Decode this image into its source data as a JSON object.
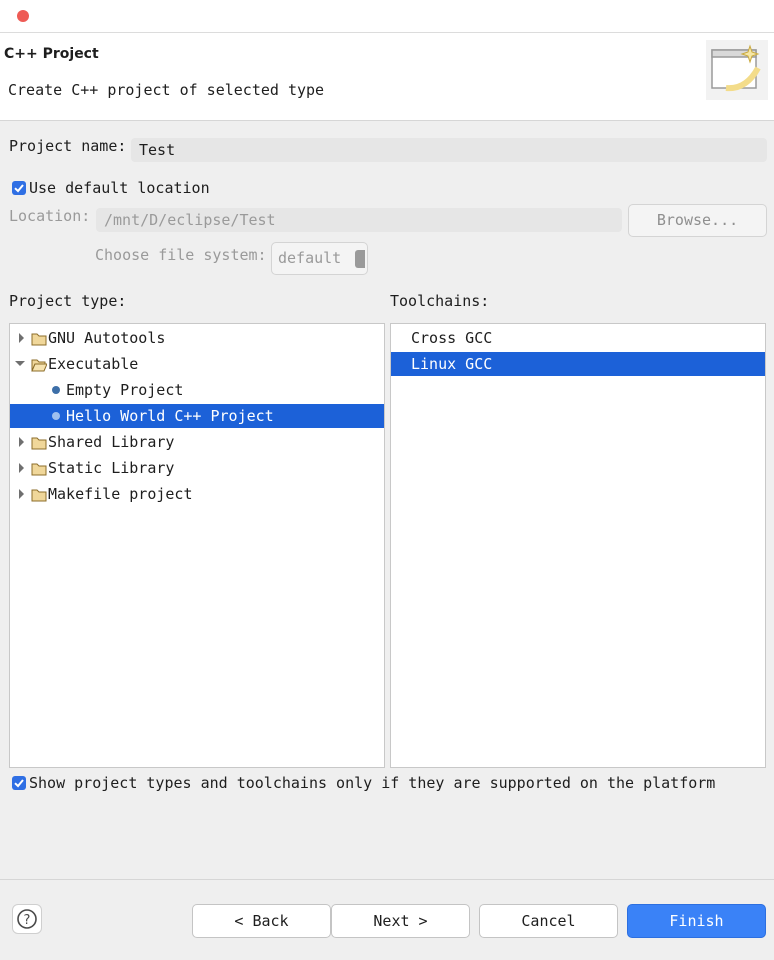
{
  "window": {
    "title": "C++ Project"
  },
  "header": {
    "title": "C++ Project",
    "description": "Create C++ project of selected type"
  },
  "project_name": {
    "label": "Project name:",
    "value": "Test"
  },
  "default_location": {
    "label": "Use default location",
    "checked": true
  },
  "location": {
    "label": "Location:",
    "value": "/mnt/D/eclipse/Test",
    "browse_label": "Browse..."
  },
  "file_system": {
    "label": "Choose file system:",
    "value": "default"
  },
  "project_type": {
    "label": "Project type:",
    "items": [
      {
        "label": "GNU Autotools",
        "kind": "folder",
        "state": "collapsed"
      },
      {
        "label": "Executable",
        "kind": "folder",
        "state": "expanded"
      },
      {
        "label": "Empty Project",
        "kind": "template"
      },
      {
        "label": "Hello World C++ Project",
        "kind": "template",
        "selected": true
      },
      {
        "label": "Shared Library",
        "kind": "folder",
        "state": "collapsed"
      },
      {
        "label": "Static Library",
        "kind": "folder",
        "state": "collapsed"
      },
      {
        "label": "Makefile project",
        "kind": "folder",
        "state": "collapsed"
      }
    ]
  },
  "toolchains": {
    "label": "Toolchains:",
    "items": [
      {
        "label": "Cross GCC"
      },
      {
        "label": "Linux GCC",
        "selected": true
      }
    ]
  },
  "supported_only": {
    "label": "Show project types and toolchains only if they are supported on the platform",
    "checked": true
  },
  "buttons": {
    "back": "< Back",
    "next": "Next >",
    "cancel": "Cancel",
    "finish": "Finish",
    "help": "?"
  },
  "colors": {
    "accent": "#3a82f7",
    "selection": "#1c61d8",
    "close": "#ee5b55"
  }
}
